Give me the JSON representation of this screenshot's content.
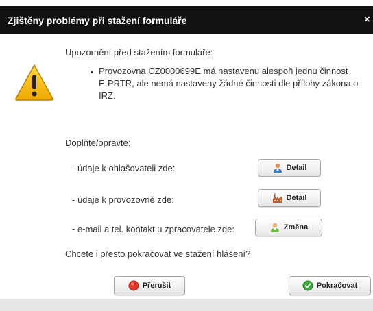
{
  "dialog": {
    "title": "Zjištěny problémy při stažení formuláře",
    "close_label": "×",
    "intro": "Upozornění před stažením formuláře:",
    "bullet_lines": [
      "Provozovna CZ0000699E má nastavenu alespoň jednu činnost",
      "E-PRTR, ale nemá nastaveny žádné činnosti dle přílohy zákona o",
      "IRZ."
    ],
    "fix_prompt": "Doplňte/opravte:",
    "rows": [
      {
        "label": "- údaje k ohlašovateli zde:",
        "button_label": "Detail",
        "icon": "person-icon"
      },
      {
        "label": "- údaje k provozovně zde:",
        "button_label": "Detail",
        "icon": "factory-icon"
      },
      {
        "label": "- e-mail a tel. kontakt u zpracovatele zde:",
        "button_label": "Změna",
        "icon": "person-edit-icon"
      }
    ],
    "question": "Chcete i přesto pokračovat ve stažení hlášení?",
    "cancel_label": "Přerušit",
    "continue_label": "Pokračovat"
  },
  "colors": {
    "titlebar": "#111111",
    "warning": "#f5b800",
    "cancel_icon": "#e03a2f",
    "continue_icon": "#3cab3c"
  }
}
